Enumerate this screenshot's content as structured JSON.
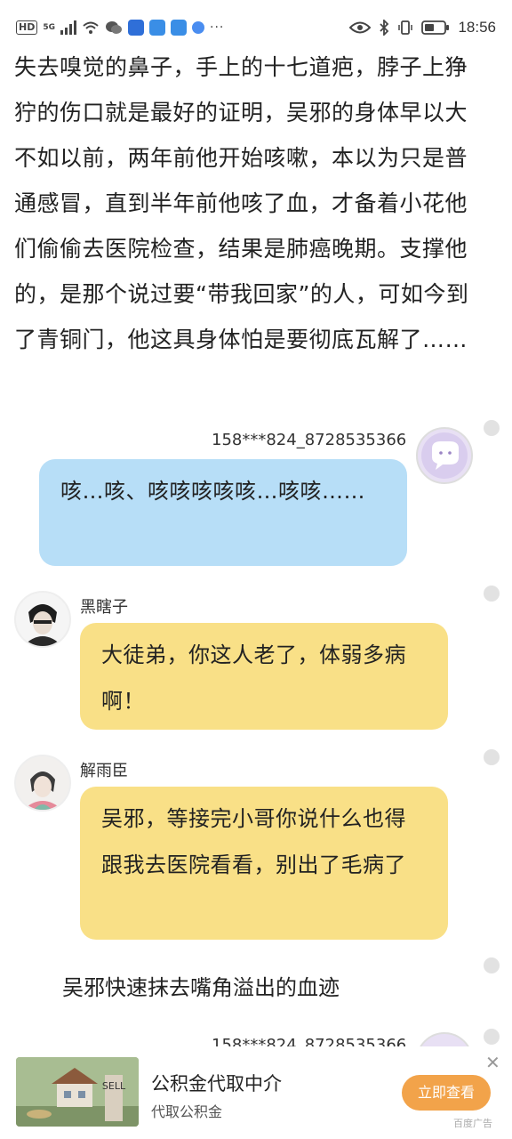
{
  "status_bar": {
    "hd": "HD",
    "net": "5G",
    "dots": "···",
    "time": "18:56",
    "app_icons": [
      {
        "name": "wechat-icon",
        "color": "#666666"
      },
      {
        "name": "shield-app-icon",
        "color": "#2f6fd8"
      },
      {
        "name": "browser-app-icon",
        "color": "#3a8ee6"
      },
      {
        "name": "browser-app-2-icon",
        "color": "#3a8ee6"
      },
      {
        "name": "map-app-icon",
        "color": "#4a8df0"
      }
    ]
  },
  "story": {
    "paragraph": "失去嗅觉的鼻子，手上的十七道疤，脖子上狰狞的伤口就是最好的证明，吴邪的身体早以大不如以前，两年前他开始咳嗽，本以为只是普通感冒，直到半年前他咳了血，才备着小花他们偷偷去医院检查，结果是肺癌晚期。支撑他的，是那个说过要“带我回家”的人，可如今到了青铜门，他这具身体怕是要彻底瓦解了……"
  },
  "messages": [
    {
      "sender": "158***824_8728535366",
      "text": "咳…咳、咳咳咳咳咳…咳咳……",
      "side": "right",
      "color": "#b7def7"
    },
    {
      "sender": "黑瞎子",
      "text": "大徒弟，你这人老了，体弱多病啊！",
      "side": "left",
      "color": "#f9e087"
    },
    {
      "sender": "解雨臣",
      "text": "吴邪，等接完小哥你说什么也得跟我去医院看看，别出了毛病了",
      "side": "left",
      "color": "#f9e087"
    }
  ],
  "narration": "吴邪快速抹去嘴角溢出的血迹",
  "partial_sender": "158***824_8728535366",
  "ad": {
    "title": "公积金代取中介",
    "subtitle": "代取公积金",
    "button": "立即查看",
    "tag": "百度广告",
    "close": "✕",
    "image_text": "SELL"
  }
}
